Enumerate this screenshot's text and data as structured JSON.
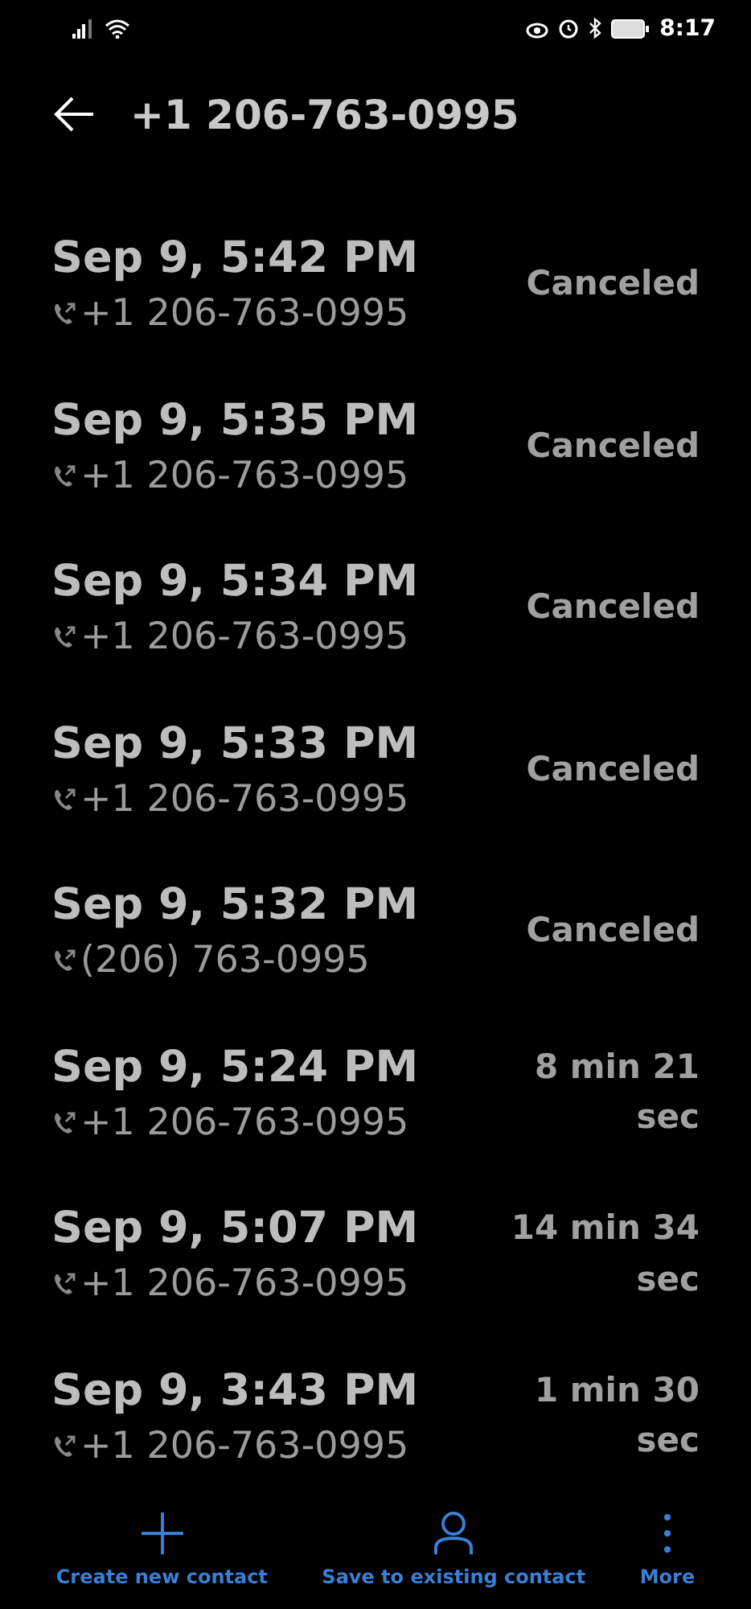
{
  "status_bar": {
    "time": "8:17"
  },
  "header": {
    "title": "+1 206-763-0995"
  },
  "calls": [
    {
      "date": "Sep 9, 5:42 PM",
      "number": "+1 206-763-0995",
      "result": "Canceled"
    },
    {
      "date": "Sep 9, 5:35 PM",
      "number": "+1 206-763-0995",
      "result": "Canceled"
    },
    {
      "date": "Sep 9, 5:34 PM",
      "number": "+1 206-763-0995",
      "result": "Canceled"
    },
    {
      "date": "Sep 9, 5:33 PM",
      "number": "+1 206-763-0995",
      "result": "Canceled"
    },
    {
      "date": "Sep 9, 5:32 PM",
      "number": "(206) 763-0995",
      "result": "Canceled"
    },
    {
      "date": "Sep 9, 5:24 PM",
      "number": "+1 206-763-0995",
      "result": "8 min 21 sec"
    },
    {
      "date": "Sep 9, 5:07 PM",
      "number": "+1 206-763-0995",
      "result": "14 min 34 sec"
    },
    {
      "date": "Sep 9, 3:43 PM",
      "number": "+1 206-763-0995",
      "result": "1 min 30 sec"
    }
  ],
  "actions": [
    {
      "kind": "add",
      "label": "Create new contact"
    },
    {
      "kind": "person",
      "label": "Save to existing contact"
    },
    {
      "kind": "more",
      "label": "More"
    }
  ]
}
